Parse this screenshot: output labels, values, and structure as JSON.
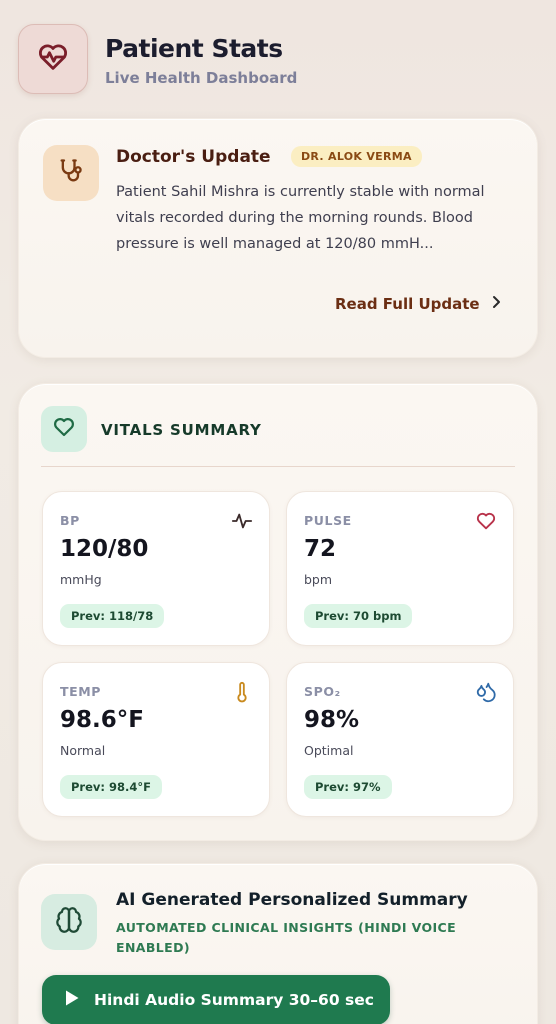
{
  "header": {
    "title": "Patient Stats",
    "subtitle": "Live Health Dashboard",
    "logo_icon": "heart-pulse-icon"
  },
  "doctor_update": {
    "title": "Doctor's Update",
    "doctor_badge": "DR. ALOK VERMA",
    "text": "Patient Sahil Mishra is currently stable with normal vitals recorded during the morning rounds. Blood pressure is well managed at 120/80 mmH...",
    "link_label": "Read Full Update",
    "icon": "stethoscope-icon"
  },
  "vitals": {
    "title": "VITALS SUMMARY",
    "icon": "heart-icon",
    "tiles": [
      {
        "label": "BP",
        "value": "120/80",
        "unit": "mmHg",
        "prev": "Prev: 118/78",
        "icon": "activity-icon"
      },
      {
        "label": "PULSE",
        "value": "72",
        "unit": "bpm",
        "prev": "Prev: 70 bpm",
        "icon": "heart-icon"
      },
      {
        "label": "TEMP",
        "value": "98.6°F",
        "unit": "Normal",
        "prev": "Prev: 98.4°F",
        "icon": "thermometer-icon"
      },
      {
        "label": "SPO₂",
        "value": "98%",
        "unit": "Optimal",
        "prev": "Prev: 97%",
        "icon": "droplets-icon"
      }
    ]
  },
  "ai_summary": {
    "title": "AI Generated Personalized Summary",
    "subtitle": "AUTOMATED CLINICAL INSIGHTS (HINDI VOICE ENABLED)",
    "button_label": "Hindi Audio Summary 30–60 sec",
    "icon": "brain-icon"
  },
  "colors": {
    "accent_green": "#1f7a4f",
    "brand_maroon": "#6b2e13",
    "badge_yellow": "#fbeec2"
  }
}
